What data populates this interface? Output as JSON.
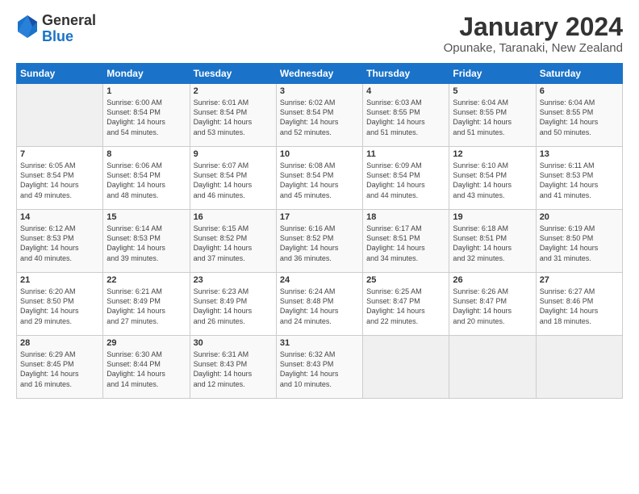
{
  "logo": {
    "general": "General",
    "blue": "Blue"
  },
  "header": {
    "title": "January 2024",
    "subtitle": "Opunake, Taranaki, New Zealand"
  },
  "weekdays": [
    "Sunday",
    "Monday",
    "Tuesday",
    "Wednesday",
    "Thursday",
    "Friday",
    "Saturday"
  ],
  "weeks": [
    [
      {
        "date": "",
        "info": ""
      },
      {
        "date": "1",
        "info": "Sunrise: 6:00 AM\nSunset: 8:54 PM\nDaylight: 14 hours\nand 54 minutes."
      },
      {
        "date": "2",
        "info": "Sunrise: 6:01 AM\nSunset: 8:54 PM\nDaylight: 14 hours\nand 53 minutes."
      },
      {
        "date": "3",
        "info": "Sunrise: 6:02 AM\nSunset: 8:54 PM\nDaylight: 14 hours\nand 52 minutes."
      },
      {
        "date": "4",
        "info": "Sunrise: 6:03 AM\nSunset: 8:55 PM\nDaylight: 14 hours\nand 51 minutes."
      },
      {
        "date": "5",
        "info": "Sunrise: 6:04 AM\nSunset: 8:55 PM\nDaylight: 14 hours\nand 51 minutes."
      },
      {
        "date": "6",
        "info": "Sunrise: 6:04 AM\nSunset: 8:55 PM\nDaylight: 14 hours\nand 50 minutes."
      }
    ],
    [
      {
        "date": "7",
        "info": "Sunrise: 6:05 AM\nSunset: 8:54 PM\nDaylight: 14 hours\nand 49 minutes."
      },
      {
        "date": "8",
        "info": "Sunrise: 6:06 AM\nSunset: 8:54 PM\nDaylight: 14 hours\nand 48 minutes."
      },
      {
        "date": "9",
        "info": "Sunrise: 6:07 AM\nSunset: 8:54 PM\nDaylight: 14 hours\nand 46 minutes."
      },
      {
        "date": "10",
        "info": "Sunrise: 6:08 AM\nSunset: 8:54 PM\nDaylight: 14 hours\nand 45 minutes."
      },
      {
        "date": "11",
        "info": "Sunrise: 6:09 AM\nSunset: 8:54 PM\nDaylight: 14 hours\nand 44 minutes."
      },
      {
        "date": "12",
        "info": "Sunrise: 6:10 AM\nSunset: 8:54 PM\nDaylight: 14 hours\nand 43 minutes."
      },
      {
        "date": "13",
        "info": "Sunrise: 6:11 AM\nSunset: 8:53 PM\nDaylight: 14 hours\nand 41 minutes."
      }
    ],
    [
      {
        "date": "14",
        "info": "Sunrise: 6:12 AM\nSunset: 8:53 PM\nDaylight: 14 hours\nand 40 minutes."
      },
      {
        "date": "15",
        "info": "Sunrise: 6:14 AM\nSunset: 8:53 PM\nDaylight: 14 hours\nand 39 minutes."
      },
      {
        "date": "16",
        "info": "Sunrise: 6:15 AM\nSunset: 8:52 PM\nDaylight: 14 hours\nand 37 minutes."
      },
      {
        "date": "17",
        "info": "Sunrise: 6:16 AM\nSunset: 8:52 PM\nDaylight: 14 hours\nand 36 minutes."
      },
      {
        "date": "18",
        "info": "Sunrise: 6:17 AM\nSunset: 8:51 PM\nDaylight: 14 hours\nand 34 minutes."
      },
      {
        "date": "19",
        "info": "Sunrise: 6:18 AM\nSunset: 8:51 PM\nDaylight: 14 hours\nand 32 minutes."
      },
      {
        "date": "20",
        "info": "Sunrise: 6:19 AM\nSunset: 8:50 PM\nDaylight: 14 hours\nand 31 minutes."
      }
    ],
    [
      {
        "date": "21",
        "info": "Sunrise: 6:20 AM\nSunset: 8:50 PM\nDaylight: 14 hours\nand 29 minutes."
      },
      {
        "date": "22",
        "info": "Sunrise: 6:21 AM\nSunset: 8:49 PM\nDaylight: 14 hours\nand 27 minutes."
      },
      {
        "date": "23",
        "info": "Sunrise: 6:23 AM\nSunset: 8:49 PM\nDaylight: 14 hours\nand 26 minutes."
      },
      {
        "date": "24",
        "info": "Sunrise: 6:24 AM\nSunset: 8:48 PM\nDaylight: 14 hours\nand 24 minutes."
      },
      {
        "date": "25",
        "info": "Sunrise: 6:25 AM\nSunset: 8:47 PM\nDaylight: 14 hours\nand 22 minutes."
      },
      {
        "date": "26",
        "info": "Sunrise: 6:26 AM\nSunset: 8:47 PM\nDaylight: 14 hours\nand 20 minutes."
      },
      {
        "date": "27",
        "info": "Sunrise: 6:27 AM\nSunset: 8:46 PM\nDaylight: 14 hours\nand 18 minutes."
      }
    ],
    [
      {
        "date": "28",
        "info": "Sunrise: 6:29 AM\nSunset: 8:45 PM\nDaylight: 14 hours\nand 16 minutes."
      },
      {
        "date": "29",
        "info": "Sunrise: 6:30 AM\nSunset: 8:44 PM\nDaylight: 14 hours\nand 14 minutes."
      },
      {
        "date": "30",
        "info": "Sunrise: 6:31 AM\nSunset: 8:43 PM\nDaylight: 14 hours\nand 12 minutes."
      },
      {
        "date": "31",
        "info": "Sunrise: 6:32 AM\nSunset: 8:43 PM\nDaylight: 14 hours\nand 10 minutes."
      },
      {
        "date": "",
        "info": ""
      },
      {
        "date": "",
        "info": ""
      },
      {
        "date": "",
        "info": ""
      }
    ]
  ]
}
